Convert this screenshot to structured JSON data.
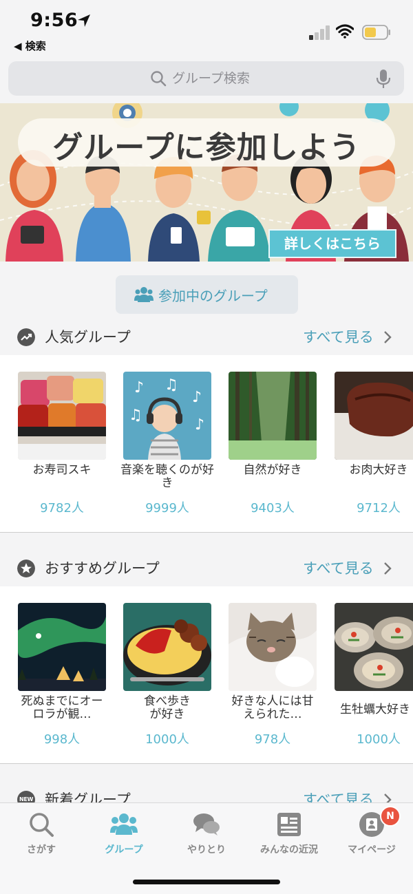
{
  "status": {
    "time": "9:56",
    "back_label": "◀ 検索"
  },
  "search": {
    "placeholder": "グループ検索"
  },
  "banner": {
    "title": "グループに参加しよう",
    "button_label": "詳しくはこちら"
  },
  "joined_button": {
    "label": "参加中のグループ"
  },
  "sections": {
    "popular": {
      "title": "人気グループ",
      "see_all": "すべて見る",
      "icon": "trending-up-icon",
      "items": [
        {
          "name": "お寿司スキ",
          "count": "9782人"
        },
        {
          "name": "音楽を聴くのが好き",
          "count": "9999人"
        },
        {
          "name": "自然が好き",
          "count": "9403人"
        },
        {
          "name": "お肉大好き",
          "count": "9712人"
        }
      ]
    },
    "recommended": {
      "title": "おすすめグループ",
      "see_all": "すべて見る",
      "icon": "star-icon",
      "items": [
        {
          "name": "死ぬまでにオーロラが観…",
          "count": "998人"
        },
        {
          "name": "食べ歩きが好き",
          "count": "1000人"
        },
        {
          "name": "好きな人には甘えられた…",
          "count": "978人"
        },
        {
          "name": "生牡蠣大好き",
          "count": "1000人"
        }
      ]
    },
    "new": {
      "title": "新着グループ",
      "see_all": "すべて見る",
      "icon_label": "NEW"
    }
  },
  "tabbar": {
    "tabs": [
      {
        "label": "さがす",
        "icon": "search-icon"
      },
      {
        "label": "グループ",
        "icon": "group-icon",
        "active": true
      },
      {
        "label": "やりとり",
        "icon": "chat-icon"
      },
      {
        "label": "みんなの近況",
        "icon": "news-icon"
      },
      {
        "label": "マイページ",
        "icon": "profile-icon"
      }
    ],
    "badge": "N"
  },
  "colors": {
    "accent": "#5bb8ce",
    "badge": "#e9533f",
    "banner_button": "#5cc3d3"
  }
}
